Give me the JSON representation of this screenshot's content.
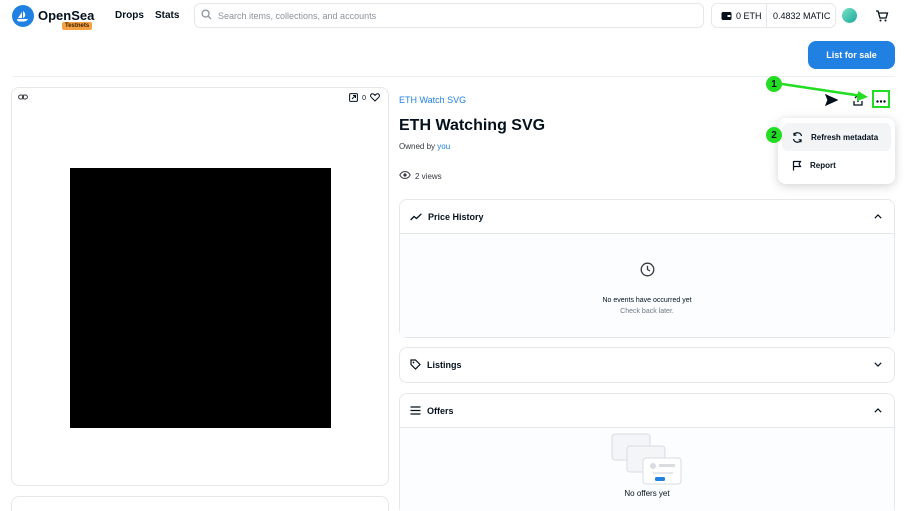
{
  "header": {
    "brand": "OpenSea",
    "badge": "Testnets",
    "nav": [
      "Drops",
      "Stats"
    ],
    "search_placeholder": "Search items, collections, and accounts",
    "eth_balance": "0 ETH",
    "matic_balance": "0.4832 MATIC"
  },
  "actions": {
    "list_for_sale": "List for sale"
  },
  "media": {
    "favorites_count": "0"
  },
  "item": {
    "collection": "ETH Watch SVG",
    "title": "ETH Watching SVG",
    "owned_by_label": "Owned by",
    "owner": "you",
    "views": "2 views"
  },
  "menu": {
    "items": [
      {
        "label": "Refresh metadata",
        "icon": "refresh-icon"
      },
      {
        "label": "Report",
        "icon": "flag-icon"
      }
    ]
  },
  "panels": {
    "price_history": {
      "title": "Price History",
      "empty_title": "No events have occurred yet",
      "empty_sub": "Check back later."
    },
    "listings": {
      "title": "Listings"
    },
    "offers": {
      "title": "Offers",
      "empty_title": "No offers yet"
    }
  },
  "annotations": {
    "step1": "1",
    "step2": "2"
  },
  "colors": {
    "brand_blue": "#2081e2",
    "annotation_green": "#22dd22",
    "badge_orange": "#f5a142"
  }
}
